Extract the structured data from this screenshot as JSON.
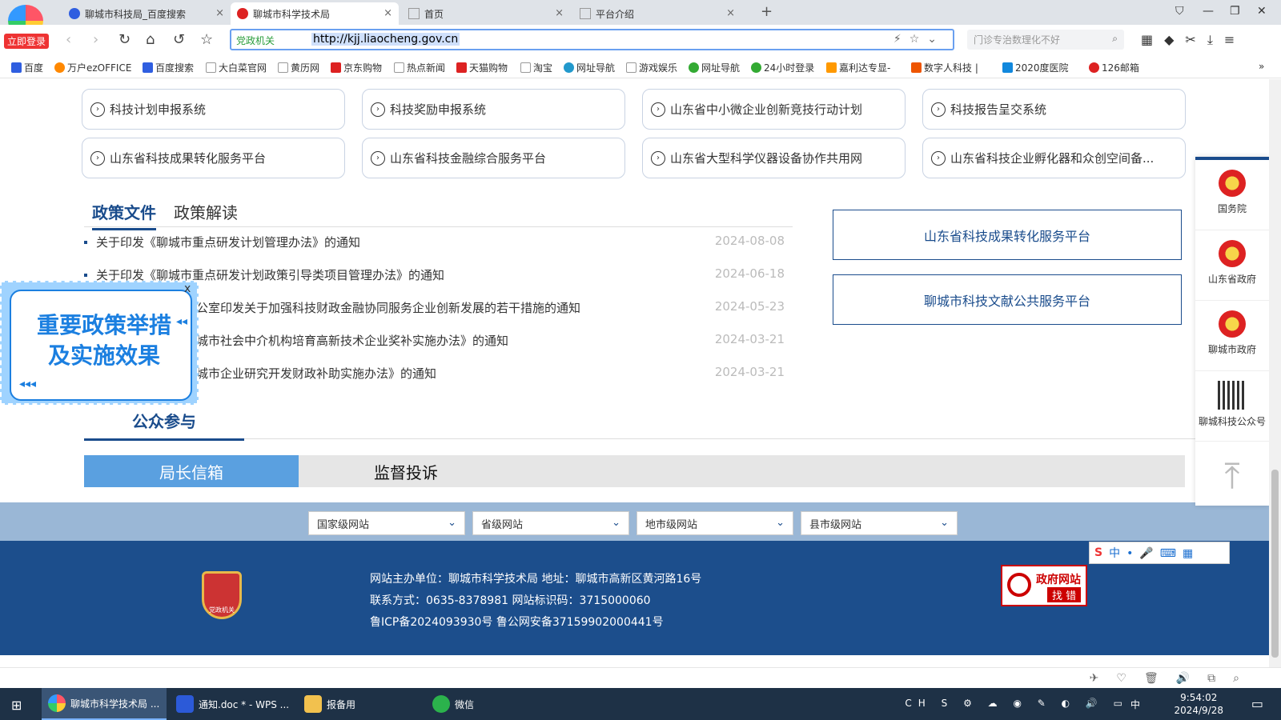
{
  "browser": {
    "login_badge": "立即登录",
    "tabs": [
      {
        "label": "聊城市科技局_百度搜索",
        "color": "#2f5ee0"
      },
      {
        "label": "聊城市科学技术局",
        "color": "#d22"
      },
      {
        "label": "首页",
        "color": "#999"
      },
      {
        "label": "平台介绍",
        "color": "#999"
      }
    ],
    "new_tab": "+",
    "url_tag": "党政机关",
    "url": "http://kjj.liaocheng.gov.cn",
    "search_placeholder": "门诊专治数理化不好",
    "bookmarks": [
      "百度",
      "万户ezOFFICE",
      "百度搜索",
      "大白菜官网",
      "黄历网",
      "京东购物",
      "热点新闻",
      "天猫购物",
      "淘宝",
      "网址导航",
      "游戏娱乐",
      "网址导航",
      "24小时登录",
      "嘉利达专显-",
      "数字人科技 |",
      "2020度医院",
      "126邮箱"
    ]
  },
  "systems": [
    "科技计划申报系统",
    "科技奖励申报系统",
    "山东省中小微企业创新竞技行动计划",
    "科技报告呈交系统",
    "山东省科技成果转化服务平台",
    "山东省科技金融综合服务平台",
    "山东省大型科学仪器设备协作共用网",
    "山东省科技企业孵化器和众创空间备..."
  ],
  "policy": {
    "tabs": [
      "政策文件",
      "政策解读"
    ],
    "items": [
      {
        "title": "关于印发《聊城市重点研发计划管理办法》的通知",
        "date": "2024-08-08"
      },
      {
        "title": "关于印发《聊城市重点研发计划政策引导类项目管理办法》的通知",
        "date": "2024-06-18"
      },
      {
        "title": "公室印发关于加强科技财政金融协同服务企业创新发展的若干措施的通知",
        "date": "2024-05-23"
      },
      {
        "title": "城市社会中介机构培育高新技术企业奖补实施办法》的通知",
        "date": "2024-03-21"
      },
      {
        "title": "城市企业研究开发财政补助实施办法》的通知",
        "date": "2024-03-21"
      }
    ]
  },
  "right_links": [
    "山东省科技成果转化服务平台",
    "聊城市科技文献公共服务平台"
  ],
  "side_panel": [
    "国务院",
    "山东省政府",
    "聊城市政府",
    "聊城科技公众号"
  ],
  "popup": {
    "line1": "重要政策举措",
    "line2": "及实施效果",
    "close": "x"
  },
  "public": {
    "title": "公众参与",
    "tabs": [
      "局长信箱",
      "监督投诉"
    ]
  },
  "site_selects": [
    "国家级网站",
    "省级网站",
    "地市级网站",
    "县市级网站"
  ],
  "footer": {
    "emblem_text": "党政机关",
    "line1": "网站主办单位：聊城市科学技术局    地址：聊城市高新区黄河路16号",
    "line2": "联系方式：0635-8378981    网站标识码：3715000060",
    "line3": "鲁ICP备2024093930号  鲁公网安备37159902000441号",
    "find_error_title": "政府网站",
    "find_error_sub": "找 错"
  },
  "taskbar": {
    "items": [
      "聊城市科学技术局 ...",
      "通知.doc * - WPS ...",
      "报备用",
      "微信"
    ],
    "time": "9:54:02",
    "date": "2024/9/28",
    "ime": "中"
  }
}
